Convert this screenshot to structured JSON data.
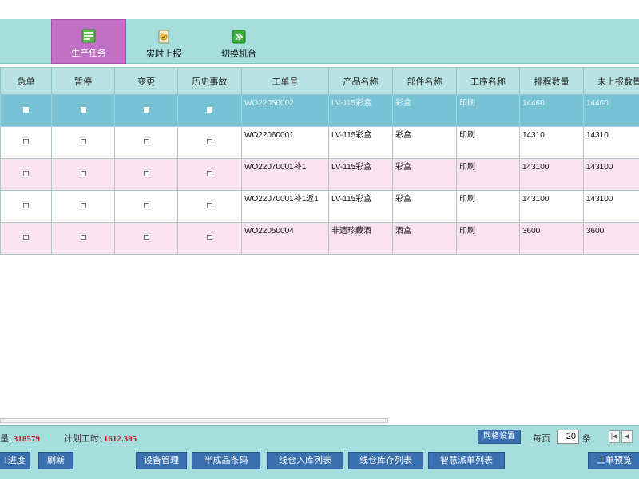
{
  "toolbar": {
    "items": [
      {
        "label": "生产任务",
        "icon": "production-task-icon",
        "active": true
      },
      {
        "label": "实时上报",
        "icon": "realtime-report-icon",
        "active": false
      },
      {
        "label": "切换机台",
        "icon": "switch-machine-icon",
        "active": false
      }
    ]
  },
  "table": {
    "headers": [
      "急单",
      "暂停",
      "变更",
      "历史事故",
      "工单号",
      "产品名称",
      "部件名称",
      "工序名称",
      "排程数量",
      "未上报数量"
    ],
    "rows": [
      {
        "style": "sel",
        "order": "WO22050002",
        "product": "LV-115彩盒",
        "part": "彩盒",
        "process": "印刷",
        "scheduled": "14460",
        "unreported": "14460"
      },
      {
        "style": "white",
        "order": "WO22060001",
        "product": "LV-115彩盒",
        "part": "彩盒",
        "process": "印刷",
        "scheduled": "14310",
        "unreported": "14310"
      },
      {
        "style": "pink",
        "order": "WO22070001补1",
        "product": "LV-115彩盒",
        "part": "彩盒",
        "process": "印刷",
        "scheduled": "143100",
        "unreported": "143100"
      },
      {
        "style": "white",
        "order": "WO22070001补1返1",
        "product": "LV-115彩盒",
        "part": "彩盒",
        "process": "印刷",
        "scheduled": "143100",
        "unreported": "143100"
      },
      {
        "style": "pink",
        "order": "WO22050004",
        "product": "非遗珍藏酒",
        "part": "酒盒",
        "process": "印刷",
        "scheduled": "3600",
        "unreported": "3600"
      }
    ]
  },
  "status": {
    "count_label": "量:",
    "count_value": "318579",
    "hours_label": "计划工时:",
    "hours_value": "1612.395",
    "grid_settings": "网格设置",
    "page_label": "每页",
    "page_size": "20",
    "page_unit": "条"
  },
  "actions": [
    {
      "label": "1进度"
    },
    {
      "label": "刷新"
    },
    {
      "label": "设备管理"
    },
    {
      "label": "半成品条码"
    },
    {
      "label": "线仓入库列表"
    },
    {
      "label": "线仓库存列表"
    },
    {
      "label": "智慧派单列表"
    },
    {
      "label": "工单预览"
    }
  ],
  "colors": {
    "toolbar_bg": "#a6dedd",
    "active_tab": "#c070c4",
    "selected_row": "#78c2d6",
    "pink_row": "#fbe2ef",
    "action_button": "#3a6fb0",
    "stat_value": "#c0182a"
  }
}
